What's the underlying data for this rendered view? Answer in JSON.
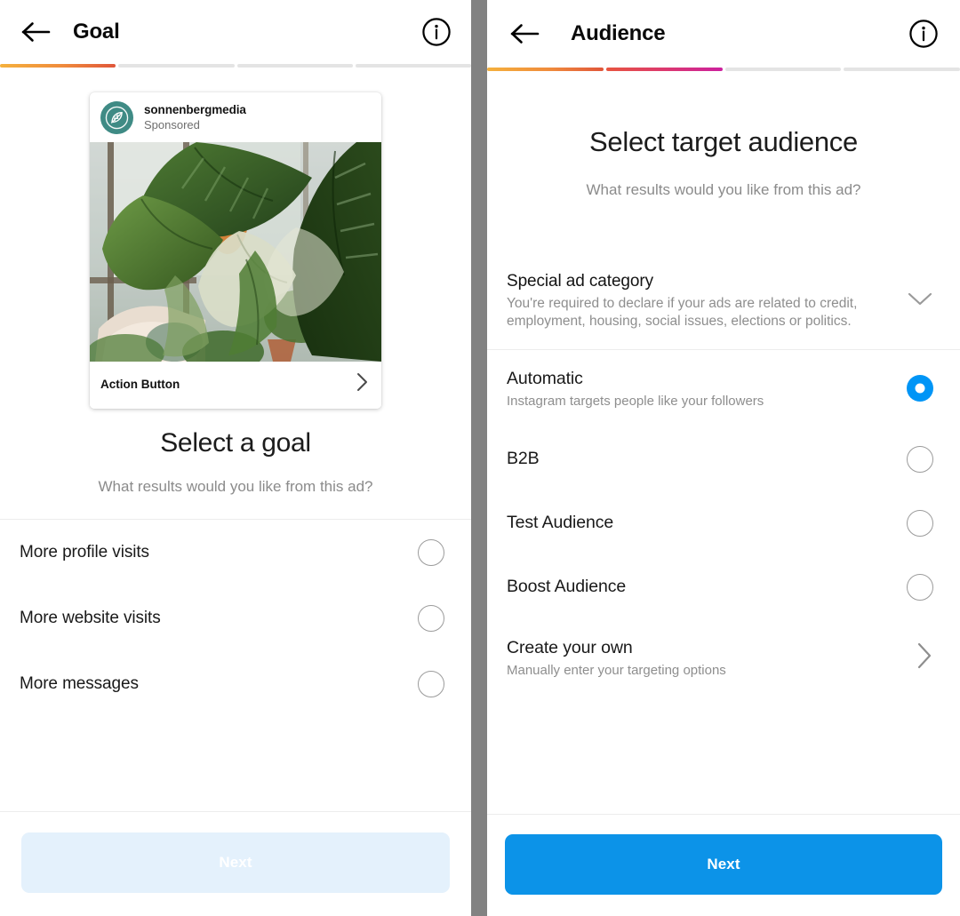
{
  "colors": {
    "accent_blue": "#0095f6",
    "next_button_blue": "#0c93e8",
    "next_button_disabled": "#e4f1fc",
    "progress_orange_start": "#f5b13d",
    "progress_orange_end": "#e0563a",
    "progress_pink_start": "#e8553f",
    "progress_pink_end": "#cc219e",
    "progress_inactive": "#e4e4e4",
    "avatar_teal": "#3f8b85",
    "divider_gray": "#828282",
    "text_primary": "#1c1c1c",
    "text_secondary": "#8b8b8b"
  },
  "left_panel": {
    "header": {
      "back_icon": "arrow-left-icon",
      "title": "Goal",
      "info_icon": "info-circle-icon"
    },
    "progress": {
      "total_segments": 4,
      "segments": [
        {
          "state": "orange"
        },
        {
          "state": "inactive"
        },
        {
          "state": "inactive"
        },
        {
          "state": "inactive"
        }
      ]
    },
    "ad_preview": {
      "avatar_icon": "leaf-logo-icon",
      "handle": "sonnenbergmedia",
      "sponsored_label": "Sponsored",
      "photo_alt": "monstera-plant-by-window-photo",
      "action_button_label": "Action Button",
      "action_chevron_icon": "chevron-right-icon"
    },
    "heading": {
      "title": "Select a goal",
      "subtitle": "What results would you like from this ad?"
    },
    "options": [
      {
        "label": "More profile visits",
        "selected": false
      },
      {
        "label": "More website visits",
        "selected": false
      },
      {
        "label": "More messages",
        "selected": false
      }
    ],
    "footer": {
      "next_label": "Next",
      "next_enabled": false
    }
  },
  "right_panel": {
    "header": {
      "back_icon": "arrow-left-icon",
      "title": "Audience",
      "info_icon": "info-circle-icon"
    },
    "progress": {
      "total_segments": 4,
      "segments": [
        {
          "state": "orange"
        },
        {
          "state": "pink"
        },
        {
          "state": "inactive"
        },
        {
          "state": "inactive"
        }
      ]
    },
    "heading": {
      "title": "Select target audience",
      "subtitle": "What results would you like from this ad?"
    },
    "special_ad_category": {
      "title": "Special ad category",
      "description": "You're required to declare if your ads are related to credit, employment, housing, social issues, elections or politics.",
      "expand_icon": "chevron-down-icon"
    },
    "options": [
      {
        "label": "Automatic",
        "description": "Instagram targets people like your followers",
        "selected": true,
        "control": "radio"
      },
      {
        "label": "B2B",
        "description": "",
        "selected": false,
        "control": "radio"
      },
      {
        "label": "Test Audience",
        "description": "",
        "selected": false,
        "control": "radio"
      },
      {
        "label": "Boost Audience",
        "description": "",
        "selected": false,
        "control": "radio"
      },
      {
        "label": "Create your own",
        "description": "Manually enter your targeting options",
        "selected": false,
        "control": "chevron"
      }
    ],
    "footer": {
      "next_label": "Next",
      "next_enabled": true
    }
  }
}
